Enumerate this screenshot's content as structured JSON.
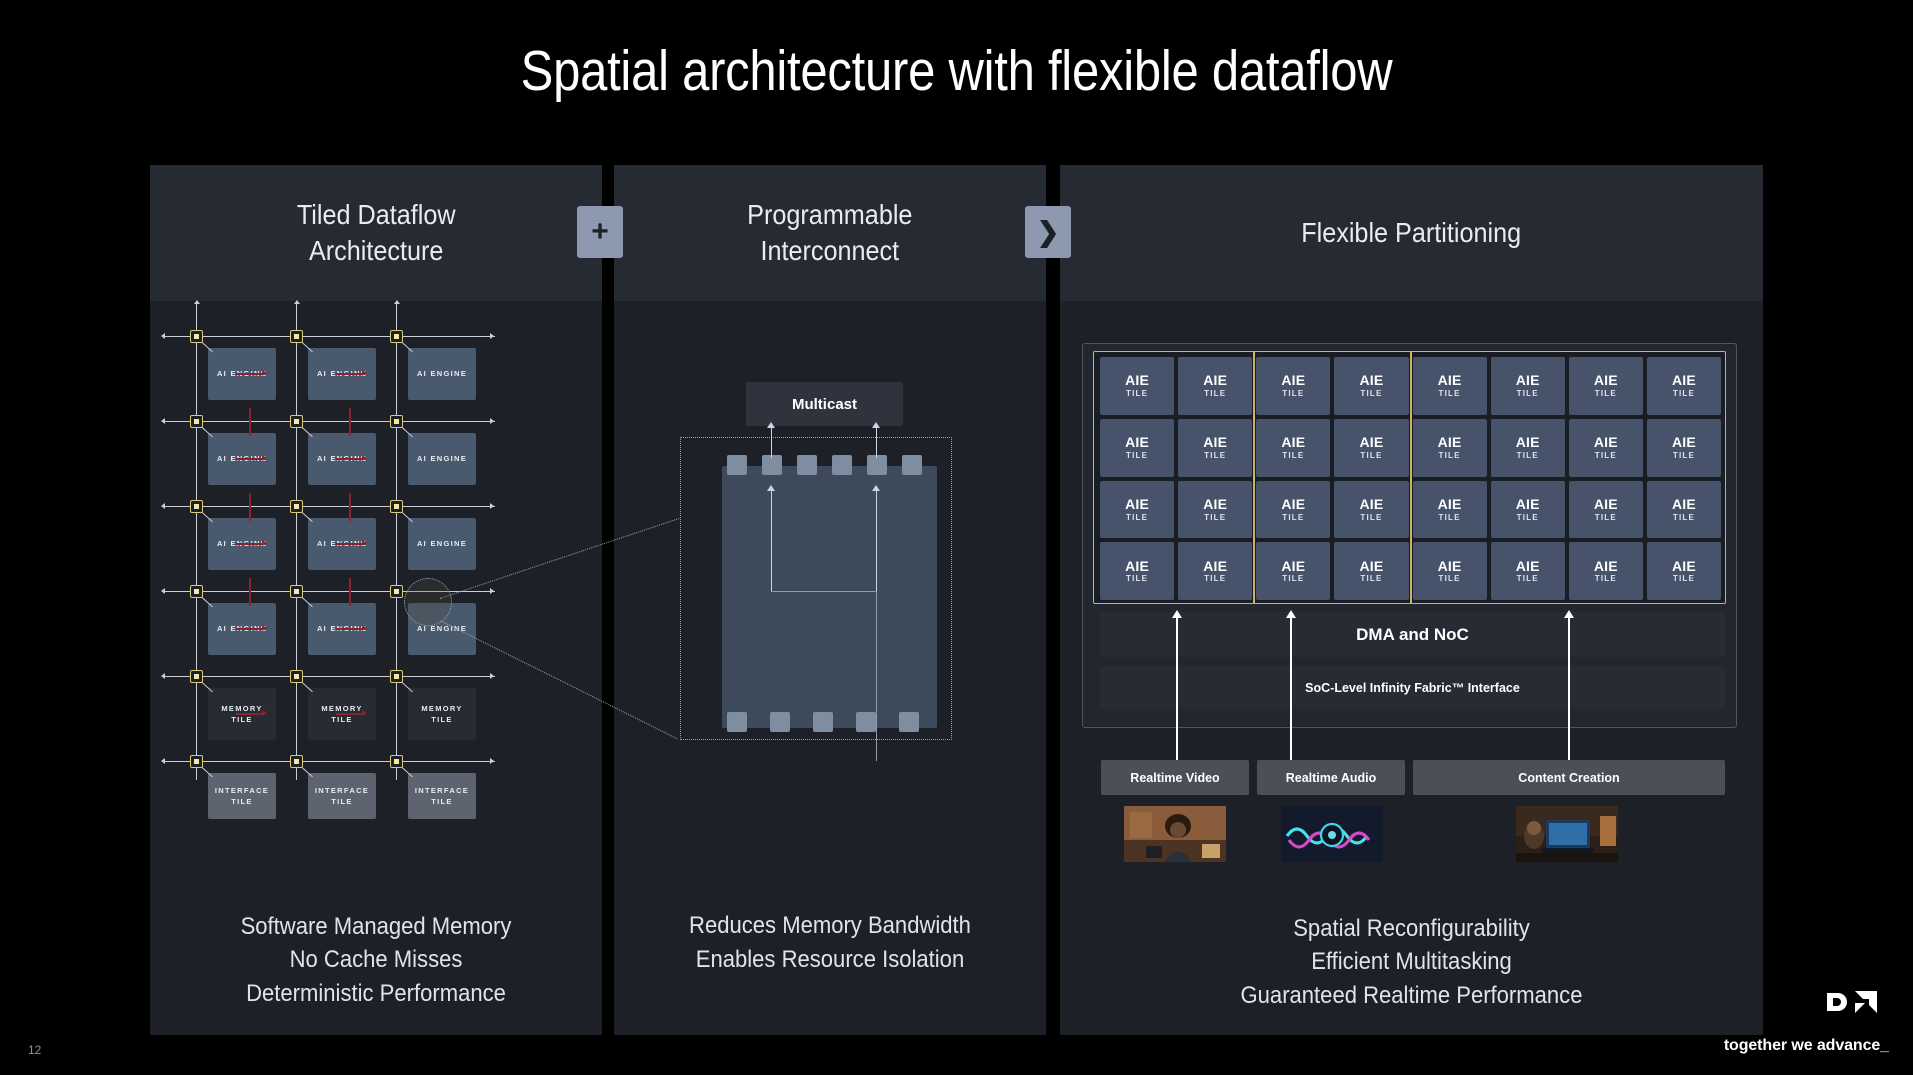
{
  "slide": {
    "title": "Spatial architecture with flexible dataflow",
    "page_number": "12",
    "background_color": "#000000",
    "panel_color": "#1d2027",
    "panel_header_color": "#262a33"
  },
  "footer": {
    "tagline": "together we advance_",
    "logo_name": "amd-logo"
  },
  "connectors": [
    {
      "name": "plus-connector",
      "glyph": "+"
    },
    {
      "name": "arrow-connector",
      "glyph": "❯"
    }
  ],
  "panels": [
    {
      "id": "tiled-dataflow",
      "header_line1": "Tiled Dataflow",
      "header_line2": "Architecture",
      "captions": [
        "Software Managed Memory",
        "No Cache Misses",
        "Deterministic Performance"
      ]
    },
    {
      "id": "programmable-interconnect",
      "header_line1": "Programmable",
      "header_line2": "Interconnect",
      "captions": [
        "Reduces Memory Bandwidth",
        "Enables Resource Isolation"
      ]
    },
    {
      "id": "flexible-partitioning",
      "header_line1": "Flexible Partitioning",
      "header_line2": "",
      "captions": [
        "Spatial Reconfigurability",
        "Efficient Multitasking",
        "Guaranteed Realtime Performance"
      ]
    }
  ],
  "dataflow_grid": {
    "ai_engine_label_line1": "AI ENGINE",
    "memory_label_line1": "MEMORY",
    "memory_label_line2": "TILE",
    "interface_label_line1": "INTERFACE",
    "interface_label_line2": "TILE",
    "columns": 3,
    "ai_engine_rows": 4,
    "memory_rows": 1,
    "interface_rows": 1,
    "switch_color": "#d9c97a",
    "ai_tile_color": "#4a5a6e",
    "memory_tile_color": "#272b34",
    "interface_tile_color": "#5d6470",
    "stream_color": "#c9ced8",
    "cascade_color": "#8b2230"
  },
  "interconnect": {
    "multicast_label": "Multicast",
    "switch_fill": "#3c4a5c",
    "port_fill": "#7f8da0",
    "top_ports": 6,
    "bottom_ports": 5
  },
  "partitioning": {
    "aie_label_line1": "AIE",
    "aie_label_line2": "TILE",
    "grid_columns": 8,
    "grid_rows": 4,
    "partition_boundary_color": "#c9b26a",
    "partition_column_groups": [
      2,
      2,
      4
    ],
    "dma_label": "DMA and NoC",
    "fabric_label": "SoC-Level Infinity Fabric™ Interface",
    "workloads": [
      {
        "label": "Realtime Video",
        "thumb": "video-thumbnail"
      },
      {
        "label": "Realtime Audio",
        "thumb": "audio-waveform-thumbnail"
      },
      {
        "label": "Content Creation",
        "thumb": "content-creation-thumbnail"
      }
    ]
  }
}
